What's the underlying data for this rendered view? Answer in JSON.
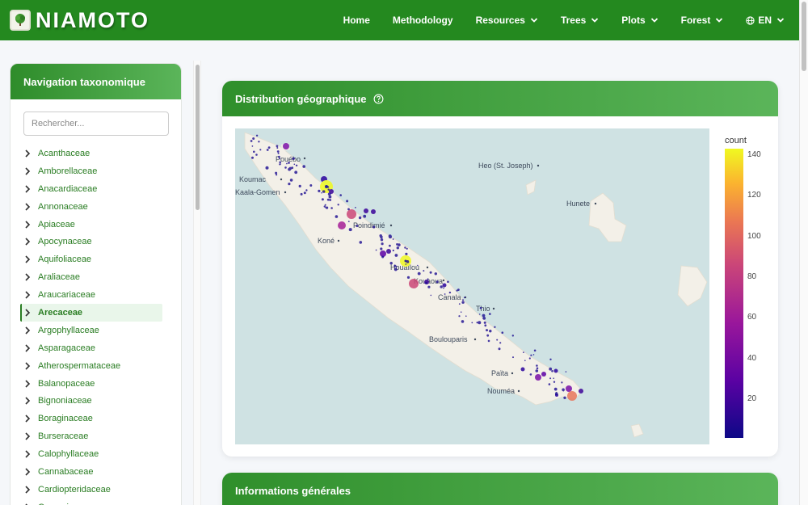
{
  "brand": {
    "name": "NIAMOTO"
  },
  "nav": {
    "items": [
      {
        "label": "Home",
        "dropdown": false
      },
      {
        "label": "Methodology",
        "dropdown": false
      },
      {
        "label": "Resources",
        "dropdown": true
      },
      {
        "label": "Trees",
        "dropdown": true
      },
      {
        "label": "Plots",
        "dropdown": true
      },
      {
        "label": "Forest",
        "dropdown": true
      },
      {
        "label": "EN",
        "dropdown": true,
        "icon": "globe-icon"
      }
    ]
  },
  "sidebar": {
    "title": "Navigation taxonomique",
    "search_placeholder": "Rechercher...",
    "active_item": "Arecaceae",
    "items": [
      "Acanthaceae",
      "Amborellaceae",
      "Anacardiaceae",
      "Annonaceae",
      "Apiaceae",
      "Apocynaceae",
      "Aquifoliaceae",
      "Araliaceae",
      "Araucariaceae",
      "Arecaceae",
      "Argophyllaceae",
      "Asparagaceae",
      "Atherospermataceae",
      "Balanopaceae",
      "Bignoniaceae",
      "Boraginaceae",
      "Burseraceae",
      "Calophyllaceae",
      "Cannabaceae",
      "Cardiopteridaceae",
      "Casuarinaceae"
    ]
  },
  "map_card": {
    "title": "Distribution géographique",
    "colorbar": {
      "title": "count",
      "ticks": [
        "140",
        "120",
        "100",
        "80",
        "60",
        "40",
        "20"
      ]
    },
    "places": [
      "Pouébo",
      "Koumac",
      "Kaala-Gomen",
      "Heo (St. Joseph)",
      "Hunete",
      "Poindimié",
      "Koné",
      "Houaïlou",
      "Kouaoua",
      "Canala",
      "Thio",
      "Boulouparis",
      "Païta",
      "Nouméa"
    ]
  },
  "info_card": {
    "title": "Informations générales"
  },
  "colors": {
    "header": "#24891f",
    "accent": "#2a7d23",
    "map_water": "#cfe2e3",
    "map_land": "#f3f0e8"
  }
}
